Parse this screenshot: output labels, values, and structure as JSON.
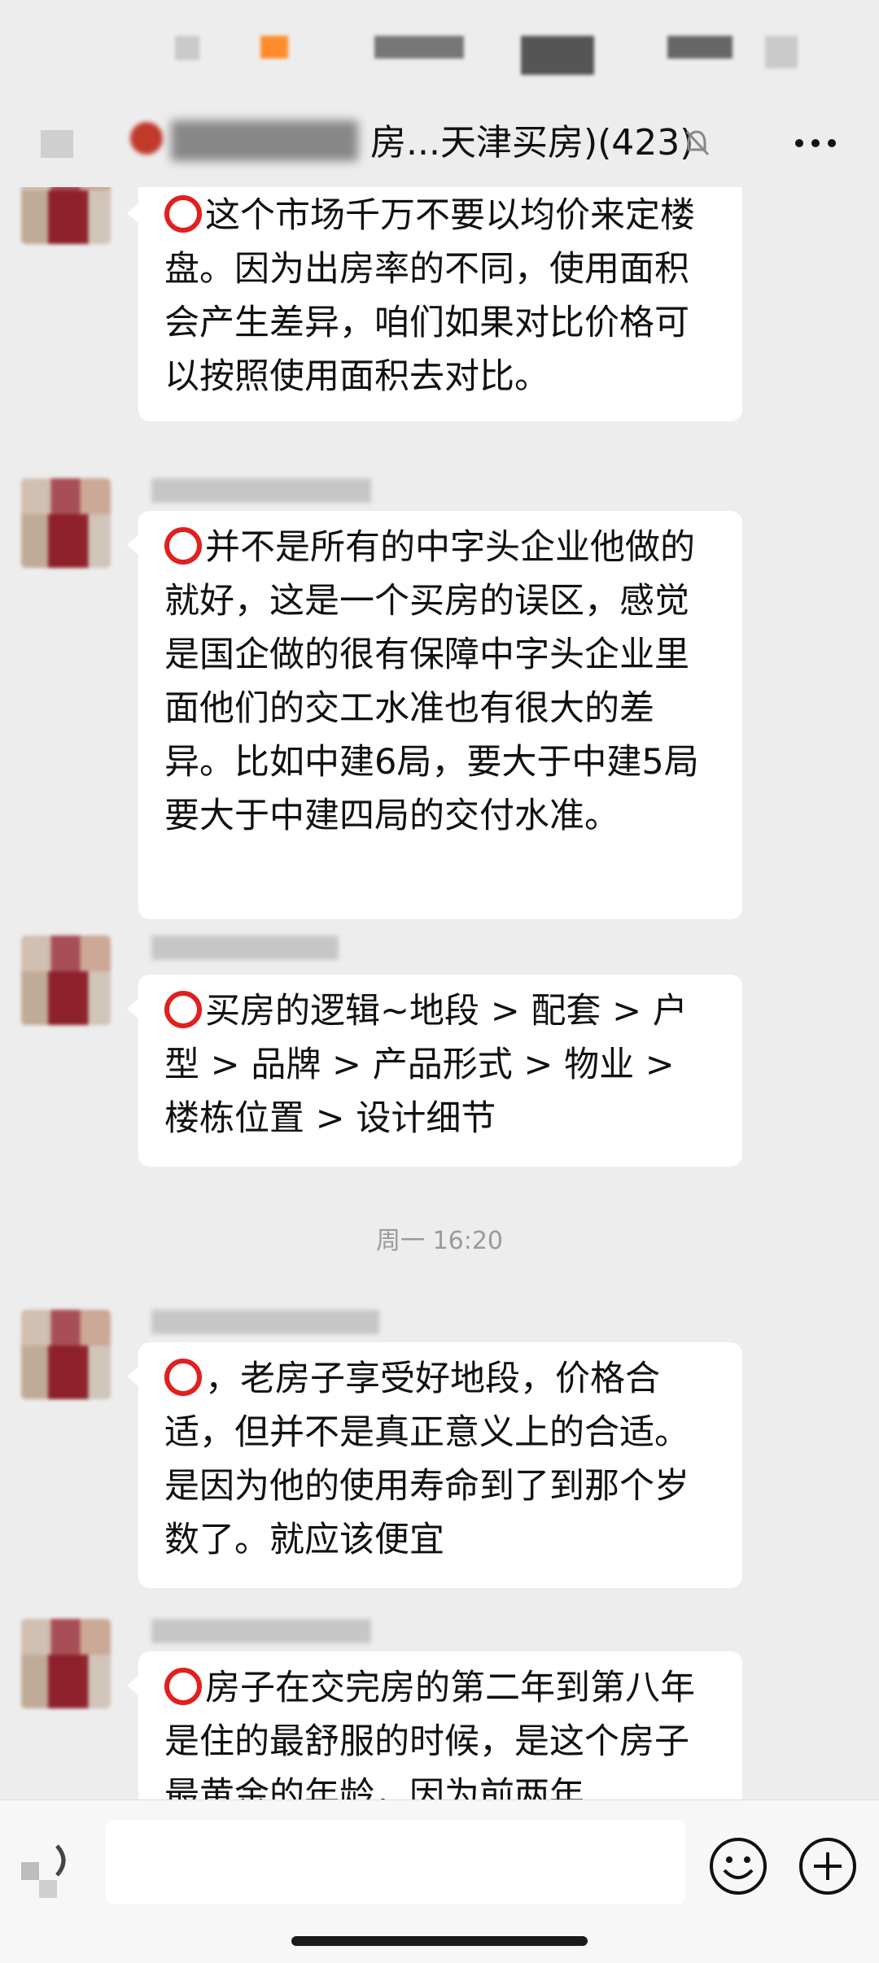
{
  "status_bar": {},
  "header": {
    "title": "房...天津买房)(423)",
    "mute_icon": "bell-muted-icon",
    "more_icon": "more-icon"
  },
  "messages": [
    {
      "text": "这个市场千万不要以均价来定楼盘。因为出房率的不同，使用面积会产生差异，咱们如果对比价格可以按照使用面积去对比。"
    },
    {
      "text": "并不是所有的中字头企业他做的就好，这是一个买房的误区，感觉是国企做的很有保障中字头企业里面他们的交工水准也有很大的差异。比如中建6局，要大于中建5局要大于中建四局的交付水准。"
    },
    {
      "text": "买房的逻辑~地段 > 配套 > 户型 > 品牌 > 产品形式 > 物业 > 楼栋位置 > 设计细节"
    },
    {
      "text": "，老房子享受好地段，价格合适，但并不是真正意义上的合适。是因为他的使用寿命到了到那个岁数了。就应该便宜"
    },
    {
      "text": "房子在交完房的第二年到第八年是住的最舒服的时候，是这个房子最黄金的年龄，因为前两年"
    }
  ],
  "timestamp": "周一 16:20",
  "input_bar": {
    "placeholder": "",
    "voice_icon": "voice-icon",
    "emoji_icon": "emoji-icon",
    "plus_icon": "plus-icon"
  },
  "colors": {
    "background": "#ededed",
    "bubble": "#ffffff",
    "ring_red": "#e02020"
  }
}
